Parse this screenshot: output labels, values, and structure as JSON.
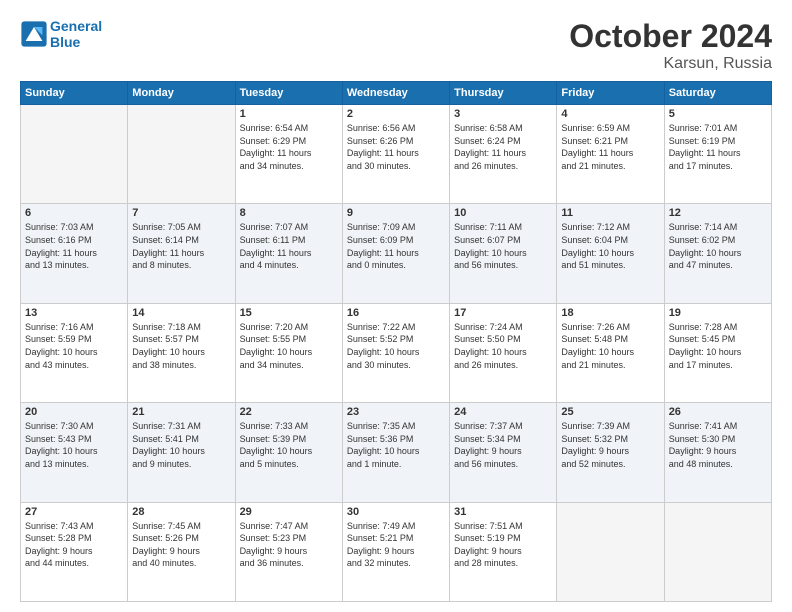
{
  "logo": {
    "line1": "General",
    "line2": "Blue"
  },
  "title": "October 2024",
  "subtitle": "Karsun, Russia",
  "weekdays": [
    "Sunday",
    "Monday",
    "Tuesday",
    "Wednesday",
    "Thursday",
    "Friday",
    "Saturday"
  ],
  "weeks": [
    [
      {
        "day": "",
        "info": ""
      },
      {
        "day": "",
        "info": ""
      },
      {
        "day": "1",
        "info": "Sunrise: 6:54 AM\nSunset: 6:29 PM\nDaylight: 11 hours\nand 34 minutes."
      },
      {
        "day": "2",
        "info": "Sunrise: 6:56 AM\nSunset: 6:26 PM\nDaylight: 11 hours\nand 30 minutes."
      },
      {
        "day": "3",
        "info": "Sunrise: 6:58 AM\nSunset: 6:24 PM\nDaylight: 11 hours\nand 26 minutes."
      },
      {
        "day": "4",
        "info": "Sunrise: 6:59 AM\nSunset: 6:21 PM\nDaylight: 11 hours\nand 21 minutes."
      },
      {
        "day": "5",
        "info": "Sunrise: 7:01 AM\nSunset: 6:19 PM\nDaylight: 11 hours\nand 17 minutes."
      }
    ],
    [
      {
        "day": "6",
        "info": "Sunrise: 7:03 AM\nSunset: 6:16 PM\nDaylight: 11 hours\nand 13 minutes."
      },
      {
        "day": "7",
        "info": "Sunrise: 7:05 AM\nSunset: 6:14 PM\nDaylight: 11 hours\nand 8 minutes."
      },
      {
        "day": "8",
        "info": "Sunrise: 7:07 AM\nSunset: 6:11 PM\nDaylight: 11 hours\nand 4 minutes."
      },
      {
        "day": "9",
        "info": "Sunrise: 7:09 AM\nSunset: 6:09 PM\nDaylight: 11 hours\nand 0 minutes."
      },
      {
        "day": "10",
        "info": "Sunrise: 7:11 AM\nSunset: 6:07 PM\nDaylight: 10 hours\nand 56 minutes."
      },
      {
        "day": "11",
        "info": "Sunrise: 7:12 AM\nSunset: 6:04 PM\nDaylight: 10 hours\nand 51 minutes."
      },
      {
        "day": "12",
        "info": "Sunrise: 7:14 AM\nSunset: 6:02 PM\nDaylight: 10 hours\nand 47 minutes."
      }
    ],
    [
      {
        "day": "13",
        "info": "Sunrise: 7:16 AM\nSunset: 5:59 PM\nDaylight: 10 hours\nand 43 minutes."
      },
      {
        "day": "14",
        "info": "Sunrise: 7:18 AM\nSunset: 5:57 PM\nDaylight: 10 hours\nand 38 minutes."
      },
      {
        "day": "15",
        "info": "Sunrise: 7:20 AM\nSunset: 5:55 PM\nDaylight: 10 hours\nand 34 minutes."
      },
      {
        "day": "16",
        "info": "Sunrise: 7:22 AM\nSunset: 5:52 PM\nDaylight: 10 hours\nand 30 minutes."
      },
      {
        "day": "17",
        "info": "Sunrise: 7:24 AM\nSunset: 5:50 PM\nDaylight: 10 hours\nand 26 minutes."
      },
      {
        "day": "18",
        "info": "Sunrise: 7:26 AM\nSunset: 5:48 PM\nDaylight: 10 hours\nand 21 minutes."
      },
      {
        "day": "19",
        "info": "Sunrise: 7:28 AM\nSunset: 5:45 PM\nDaylight: 10 hours\nand 17 minutes."
      }
    ],
    [
      {
        "day": "20",
        "info": "Sunrise: 7:30 AM\nSunset: 5:43 PM\nDaylight: 10 hours\nand 13 minutes."
      },
      {
        "day": "21",
        "info": "Sunrise: 7:31 AM\nSunset: 5:41 PM\nDaylight: 10 hours\nand 9 minutes."
      },
      {
        "day": "22",
        "info": "Sunrise: 7:33 AM\nSunset: 5:39 PM\nDaylight: 10 hours\nand 5 minutes."
      },
      {
        "day": "23",
        "info": "Sunrise: 7:35 AM\nSunset: 5:36 PM\nDaylight: 10 hours\nand 1 minute."
      },
      {
        "day": "24",
        "info": "Sunrise: 7:37 AM\nSunset: 5:34 PM\nDaylight: 9 hours\nand 56 minutes."
      },
      {
        "day": "25",
        "info": "Sunrise: 7:39 AM\nSunset: 5:32 PM\nDaylight: 9 hours\nand 52 minutes."
      },
      {
        "day": "26",
        "info": "Sunrise: 7:41 AM\nSunset: 5:30 PM\nDaylight: 9 hours\nand 48 minutes."
      }
    ],
    [
      {
        "day": "27",
        "info": "Sunrise: 7:43 AM\nSunset: 5:28 PM\nDaylight: 9 hours\nand 44 minutes."
      },
      {
        "day": "28",
        "info": "Sunrise: 7:45 AM\nSunset: 5:26 PM\nDaylight: 9 hours\nand 40 minutes."
      },
      {
        "day": "29",
        "info": "Sunrise: 7:47 AM\nSunset: 5:23 PM\nDaylight: 9 hours\nand 36 minutes."
      },
      {
        "day": "30",
        "info": "Sunrise: 7:49 AM\nSunset: 5:21 PM\nDaylight: 9 hours\nand 32 minutes."
      },
      {
        "day": "31",
        "info": "Sunrise: 7:51 AM\nSunset: 5:19 PM\nDaylight: 9 hours\nand 28 minutes."
      },
      {
        "day": "",
        "info": ""
      },
      {
        "day": "",
        "info": ""
      }
    ]
  ]
}
